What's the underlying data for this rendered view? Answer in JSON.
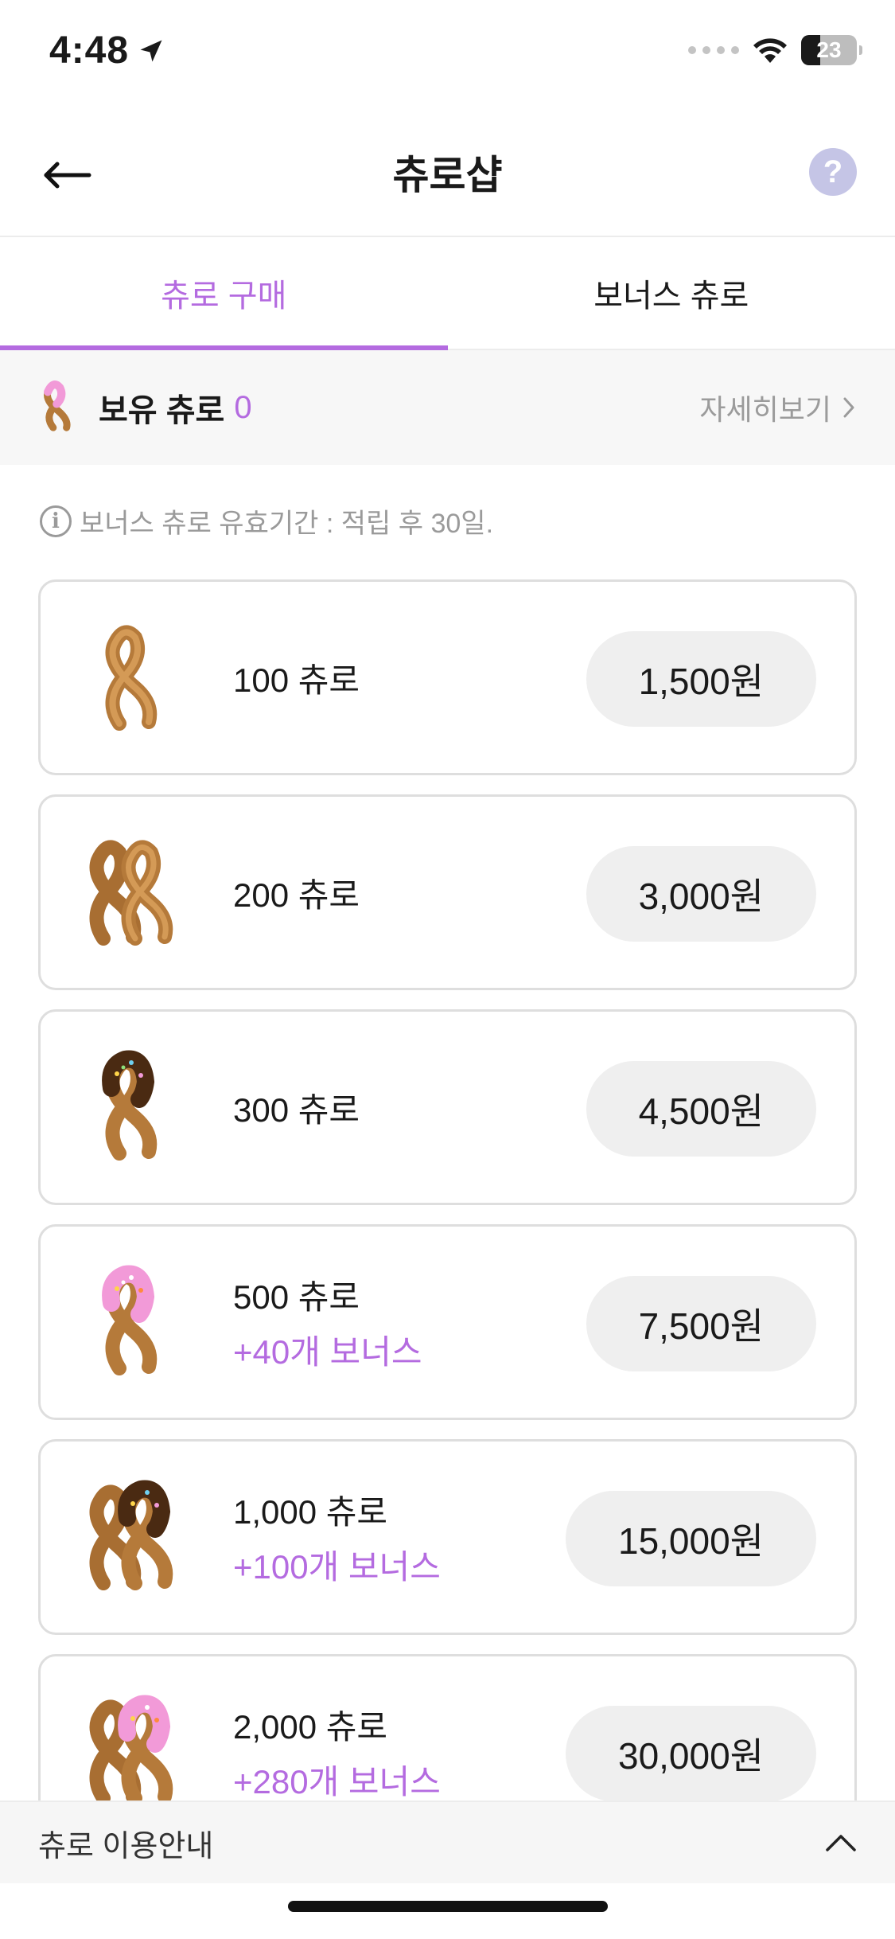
{
  "status": {
    "time": "4:48",
    "battery": "23"
  },
  "header": {
    "title": "츄로샵",
    "help_glyph": "?"
  },
  "tabs": [
    {
      "label": "츄로 구매",
      "active": true
    },
    {
      "label": "보너스 츄로",
      "active": false
    }
  ],
  "balance": {
    "label": "보유 츄로",
    "count": "0",
    "details_label": "자세히보기"
  },
  "notice": {
    "text": "보너스 츄로 유효기간 : 적립 후 30일."
  },
  "products": [
    {
      "name": "100 츄로",
      "bonus": "",
      "price": "1,500원",
      "icon": "churro-plain-icon"
    },
    {
      "name": "200 츄로",
      "bonus": "",
      "price": "3,000원",
      "icon": "churro-double-plain-icon"
    },
    {
      "name": "300 츄로",
      "bonus": "",
      "price": "4,500원",
      "icon": "churro-chocolate-icon"
    },
    {
      "name": "500 츄로",
      "bonus": "+40개 보너스",
      "price": "7,500원",
      "icon": "churro-pink-icon"
    },
    {
      "name": "1,000 츄로",
      "bonus": "+100개 보너스",
      "price": "15,000원",
      "icon": "churro-double-chocolate-icon"
    },
    {
      "name": "2,000 츄로",
      "bonus": "+280개 보너스",
      "price": "30,000원",
      "icon": "churro-double-pink-icon"
    }
  ],
  "footer": {
    "guide_label": "츄로 이용안내"
  },
  "colors": {
    "accent": "#b46be0",
    "churro": "#b57a3a",
    "chocolate": "#4a2a12",
    "pink": "#f29ad8"
  }
}
